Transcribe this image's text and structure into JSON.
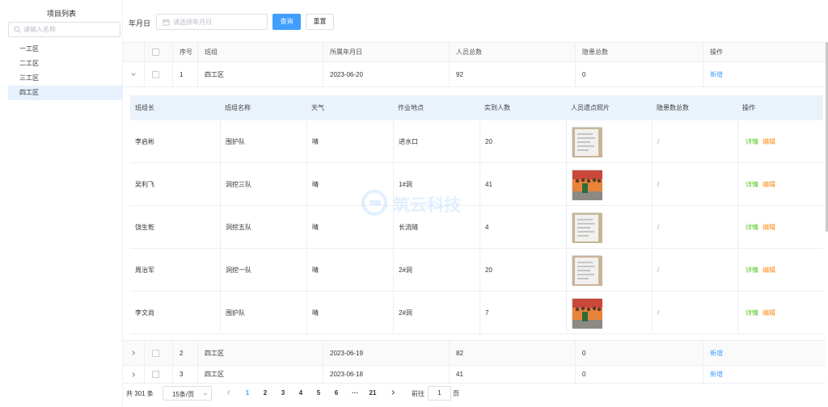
{
  "sidebar": {
    "title": "项目列表",
    "search_placeholder": "请输入名称",
    "items": [
      {
        "label": "一工区"
      },
      {
        "label": "二工区"
      },
      {
        "label": "三工区"
      },
      {
        "label": "四工区"
      }
    ]
  },
  "filter": {
    "date_label": "年月日",
    "date_placeholder": "请选择年月日",
    "query_label": "查询",
    "reset_label": "重置"
  },
  "table": {
    "headers": {
      "index": "序号",
      "team": "班组",
      "date": "所属年月日",
      "total_people": "人员总数",
      "total_hazards": "隐患总数",
      "actions": "操作"
    },
    "rows": [
      {
        "index": "1",
        "team": "四工区",
        "date": "2023-06-20",
        "total_people": "92",
        "total_hazards": "0",
        "action": "新增"
      },
      {
        "index": "2",
        "team": "四工区",
        "date": "2023-06-19",
        "total_people": "82",
        "total_hazards": "0",
        "action": "新增"
      },
      {
        "index": "3",
        "team": "四工区",
        "date": "2023-06-18",
        "total_people": "41",
        "total_hazards": "0",
        "action": "新增"
      }
    ]
  },
  "subtable": {
    "headers": {
      "leader": "班组长",
      "team_name": "班组名称",
      "weather": "天气",
      "location": "作业地点",
      "actual_count": "实到人数",
      "photo": "人员遗点照片",
      "hazards": "隐患数总数",
      "actions": "操作"
    },
    "detail_label": "详情",
    "edit_label": "编辑",
    "rows": [
      {
        "leader": "李启彬",
        "team_name": "围护队",
        "weather": "晴",
        "location": "进水口",
        "actual_count": "20",
        "hazards": "/",
        "photo_style": "paper"
      },
      {
        "leader": "吴利飞",
        "team_name": "洞挖三队",
        "weather": "晴",
        "location": "1#洞",
        "actual_count": "41",
        "hazards": "/",
        "photo_style": "crowd"
      },
      {
        "leader": "饶生乾",
        "team_name": "洞挖五队",
        "weather": "晴",
        "location": "长流隧",
        "actual_count": "4",
        "hazards": "/",
        "photo_style": "paper"
      },
      {
        "leader": "周治军",
        "team_name": "洞挖一队",
        "weather": "晴",
        "location": "2#洞",
        "actual_count": "20",
        "hazards": "/",
        "photo_style": "paper"
      },
      {
        "leader": "李文尚",
        "team_name": "围护队",
        "weather": "晴",
        "location": "2#洞",
        "actual_count": "7",
        "hazards": "/",
        "photo_style": "crowd"
      }
    ]
  },
  "watermark": {
    "text": "筑云科技"
  },
  "pagination": {
    "total_text": "共 301 条",
    "page_size": "15条/页",
    "pages": [
      "1",
      "2",
      "3",
      "4",
      "5",
      "6",
      "···",
      "21"
    ],
    "goto_label": "前往",
    "goto_value": "1",
    "page_suffix": "页"
  },
  "colors": {
    "primary": "#409eff",
    "detail": "#52c41a",
    "edit": "#fa8c16",
    "active_bg": "#e6f1fd"
  }
}
